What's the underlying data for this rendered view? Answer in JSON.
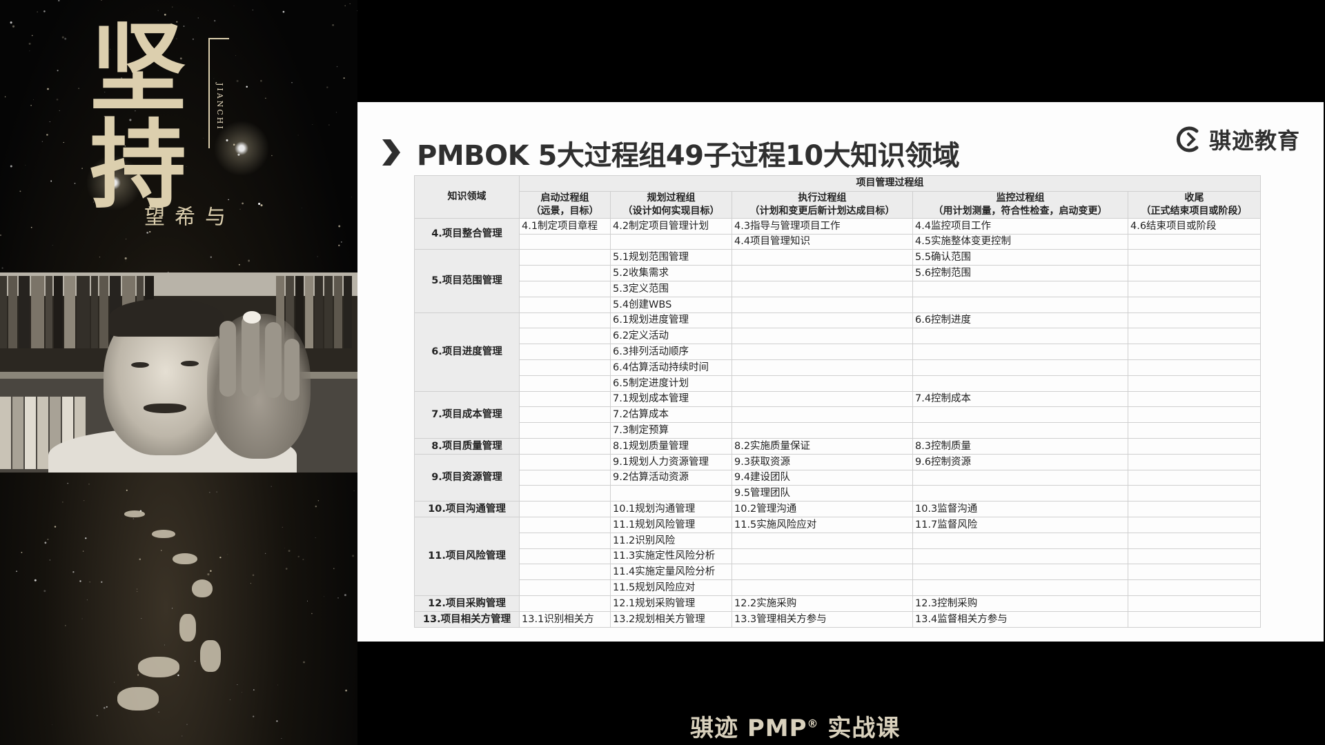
{
  "poster": {
    "calligraphy_main": "坚持",
    "calligraphy_sub": "与希望",
    "pinyin": "JIANCHI"
  },
  "slide": {
    "title": "PMBOK 5大过程组49子过程10大知识领域",
    "brand": "骐迹教育",
    "table": {
      "group_header": "项目管理过程组",
      "area_header": "知识领域",
      "columns": [
        {
          "name": "启动过程组",
          "desc": "（远景，目标）"
        },
        {
          "name": "规划过程组",
          "desc": "（设计如何实现目标）"
        },
        {
          "name": "执行过程组",
          "desc": "（计划和变更后新计划达成目标）"
        },
        {
          "name": "监控过程组",
          "desc": "（用计划测量，符合性检查，启动变更）"
        },
        {
          "name": "收尾",
          "desc": "（正式结束项目或阶段）"
        }
      ],
      "areas": [
        {
          "name": "4.项目整合管理",
          "rows": [
            [
              "4.1制定项目章程",
              "4.2制定项目管理计划",
              "4.3指导与管理项目工作",
              "4.4监控项目工作",
              "4.6结束项目或阶段"
            ],
            [
              "",
              "",
              "4.4项目管理知识",
              "4.5实施整体变更控制",
              ""
            ]
          ]
        },
        {
          "name": "5.项目范围管理",
          "rows": [
            [
              "",
              "5.1规划范围管理",
              "",
              "5.5确认范围",
              ""
            ],
            [
              "",
              "5.2收集需求",
              "",
              "5.6控制范围",
              ""
            ],
            [
              "",
              "5.3定义范围",
              "",
              "",
              ""
            ],
            [
              "",
              "5.4创建WBS",
              "",
              "",
              ""
            ]
          ]
        },
        {
          "name": "6.项目进度管理",
          "rows": [
            [
              "",
              "6.1规划进度管理",
              "",
              "6.6控制进度",
              ""
            ],
            [
              "",
              "6.2定义活动",
              "",
              "",
              ""
            ],
            [
              "",
              "6.3排列活动顺序",
              "",
              "",
              ""
            ],
            [
              "",
              "6.4估算活动持续时间",
              "",
              "",
              ""
            ],
            [
              "",
              "6.5制定进度计划",
              "",
              "",
              ""
            ]
          ]
        },
        {
          "name": "7.项目成本管理",
          "rows": [
            [
              "",
              "7.1规划成本管理",
              "",
              "7.4控制成本",
              ""
            ],
            [
              "",
              "7.2估算成本",
              "",
              "",
              ""
            ],
            [
              "",
              "7.3制定预算",
              "",
              "",
              ""
            ]
          ]
        },
        {
          "name": "8.项目质量管理",
          "rows": [
            [
              "",
              "8.1规划质量管理",
              "8.2实施质量保证",
              "8.3控制质量",
              ""
            ]
          ]
        },
        {
          "name": "9.项目资源管理",
          "rows": [
            [
              "",
              "9.1规划人力资源管理",
              "9.3获取资源",
              "9.6控制资源",
              ""
            ],
            [
              "",
              "9.2估算活动资源",
              "9.4建设团队",
              "",
              ""
            ],
            [
              "",
              "",
              "9.5管理团队",
              "",
              ""
            ]
          ]
        },
        {
          "name": "10.项目沟通管理",
          "rows": [
            [
              "",
              "10.1规划沟通管理",
              "10.2管理沟通",
              "10.3监督沟通",
              ""
            ]
          ]
        },
        {
          "name": "11.项目风险管理",
          "rows": [
            [
              "",
              "11.1规划风险管理",
              "11.5实施风险应对",
              "11.7监督风险",
              ""
            ],
            [
              "",
              "11.2识别风险",
              "",
              "",
              ""
            ],
            [
              "",
              "11.3实施定性风险分析",
              "",
              "",
              ""
            ],
            [
              "",
              "11.4实施定量风险分析",
              "",
              "",
              ""
            ],
            [
              "",
              "11.5规划风险应对",
              "",
              "",
              ""
            ]
          ]
        },
        {
          "name": "12.项目采购管理",
          "rows": [
            [
              "",
              "12.1规划采购管理",
              "12.2实施采购",
              "12.3控制采购",
              ""
            ]
          ]
        },
        {
          "name": "13.项目相关方管理",
          "rows": [
            [
              "13.1识别相关方",
              "13.2规划相关方管理",
              "13.3管理相关方参与",
              "13.4监督相关方参与",
              ""
            ]
          ]
        }
      ]
    }
  },
  "caption": {
    "text_before": "骐迹 PMP",
    "registered": "®",
    "text_after": " 实战课"
  },
  "colors": {
    "background": "#000000",
    "slide_bg": "#fdfdfd",
    "header_fill": "#ececec",
    "caption": "#d9d1bd"
  }
}
